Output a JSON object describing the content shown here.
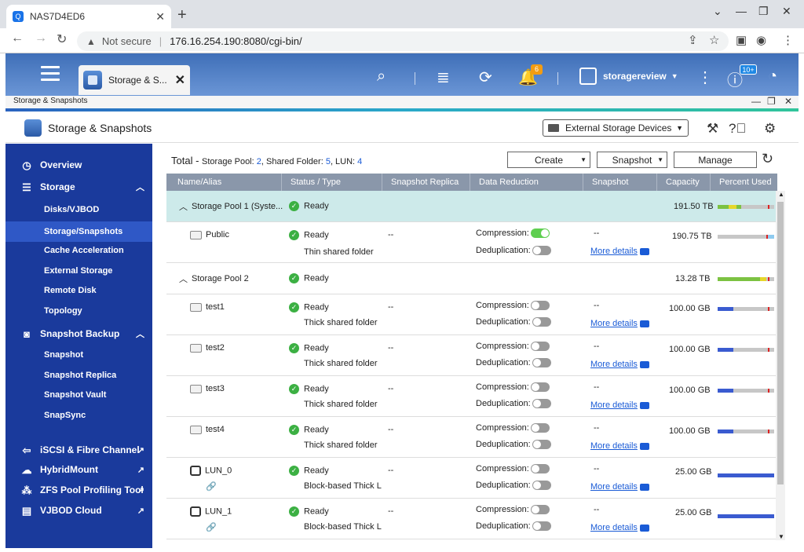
{
  "browser": {
    "tab_title": "NAS7D4ED6",
    "warning": "Not secure",
    "url": "176.16.254.190:8080/cgi-bin/"
  },
  "qts": {
    "app_tab": "Storage & S...",
    "badge_notify": "6",
    "badge_count": "10+",
    "user": "storagereview"
  },
  "app": {
    "window_title": "Storage & Snapshots",
    "title": "Storage & Snapshots",
    "external_btn": "External Storage Devices"
  },
  "sidebar": {
    "overview": "Overview",
    "storage": "Storage",
    "storage_items": [
      "Disks/VJBOD",
      "Storage/Snapshots",
      "Cache Acceleration",
      "External Storage",
      "Remote Disk",
      "Topology"
    ],
    "snapshot_backup": "Snapshot Backup",
    "snapshot_items": [
      "Snapshot",
      "Snapshot Replica",
      "Snapshot Vault",
      "SnapSync"
    ],
    "bottom_items": [
      "iSCSI & Fibre Channel",
      "HybridMount",
      "ZFS Pool Profiling Tool",
      "VJBOD Cloud"
    ]
  },
  "summary": {
    "total": "Total",
    "dash": " - ",
    "pool_lbl": "Storage Pool: ",
    "pool": "2",
    "folder_lbl": ", Shared Folder: ",
    "folder": "5",
    "lun_lbl": ", LUN: ",
    "lun": "4"
  },
  "toolbar": {
    "create": "Create",
    "snapshot": "Snapshot",
    "manage": "Manage"
  },
  "columns": [
    "Name/Alias",
    "Status / Type",
    "Snapshot Replica",
    "Data Reduction",
    "Snapshot",
    "Capacity",
    "Percent Used"
  ],
  "labels": {
    "compression": "Compression:",
    "dedup": "Deduplication:",
    "more": "More details",
    "dash": "--"
  },
  "pools": [
    {
      "name": "Storage Pool 1 (Syste...",
      "status": "Ready",
      "capacity": "191.50 TB"
    },
    {
      "name": "Storage Pool 2",
      "status": "Ready",
      "capacity": "13.28 TB"
    }
  ],
  "rows": [
    {
      "name": "Public",
      "status": "Ready",
      "type": "Thin shared folder",
      "capacity": "190.75 TB"
    },
    {
      "name": "test1",
      "status": "Ready",
      "type": "Thick shared folder",
      "capacity": "100.00 GB"
    },
    {
      "name": "test2",
      "status": "Ready",
      "type": "Thick shared folder",
      "capacity": "100.00 GB"
    },
    {
      "name": "test3",
      "status": "Ready",
      "type": "Thick shared folder",
      "capacity": "100.00 GB"
    },
    {
      "name": "test4",
      "status": "Ready",
      "type": "Thick shared folder",
      "capacity": "100.00 GB"
    },
    {
      "name": "LUN_0",
      "status": "Ready",
      "type": "Block-based Thick L",
      "capacity": "25.00 GB"
    },
    {
      "name": "LUN_1",
      "status": "Ready",
      "type": "Block-based Thick L",
      "capacity": "25.00 GB"
    }
  ]
}
